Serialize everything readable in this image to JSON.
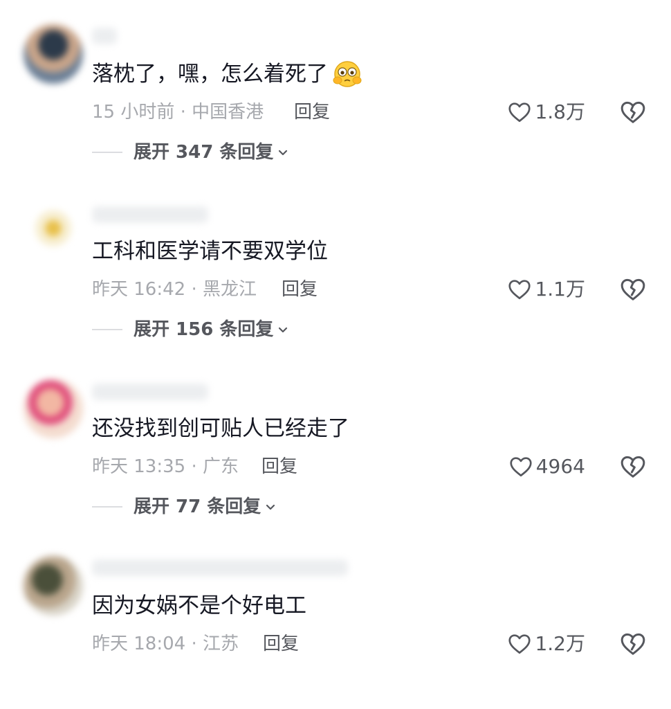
{
  "comments": [
    {
      "text": "落枕了，嘿，怎么着死了",
      "emoji_name": "blushing-peek-emoji",
      "meta": "15 小时前 · 中国香港",
      "reply_label": "回复",
      "likes": "1.8万",
      "expand_label": "展开 347 条回复",
      "avatar_colors": [
        "#2c3a4a",
        "#c9a58a",
        "#6b7f96"
      ]
    },
    {
      "text": "工科和医学请不要双学位",
      "meta": "昨天 16:42 · 黑龙江",
      "reply_label": "回复",
      "likes": "1.1万",
      "expand_label": "展开 156 条回复",
      "avatar_colors": [
        "#e8c04a",
        "#f7eed0",
        "#ffffff"
      ]
    },
    {
      "text": "还没找到创可贴人已经走了",
      "meta": "昨天 13:35 · 广东",
      "reply_label": "回复",
      "likes": "4964",
      "expand_label": "展开 77 条回复",
      "avatar_colors": [
        "#f2b7a3",
        "#e04a7a",
        "#f4dccf"
      ]
    },
    {
      "text": "因为女娲不是个好电工",
      "meta": "昨天 18:04 · 江苏",
      "reply_label": "回复",
      "likes": "1.2万",
      "avatar_colors": [
        "#4a4f3a",
        "#b9a58c",
        "#d9d4c8"
      ]
    }
  ],
  "icons": {
    "like": "heart-outline-icon",
    "dislike": "broken-heart-icon",
    "expand": "chevron-down-icon"
  },
  "colors": {
    "text": "#161823",
    "meta": "#a6a8ad",
    "action": "#55575d"
  }
}
